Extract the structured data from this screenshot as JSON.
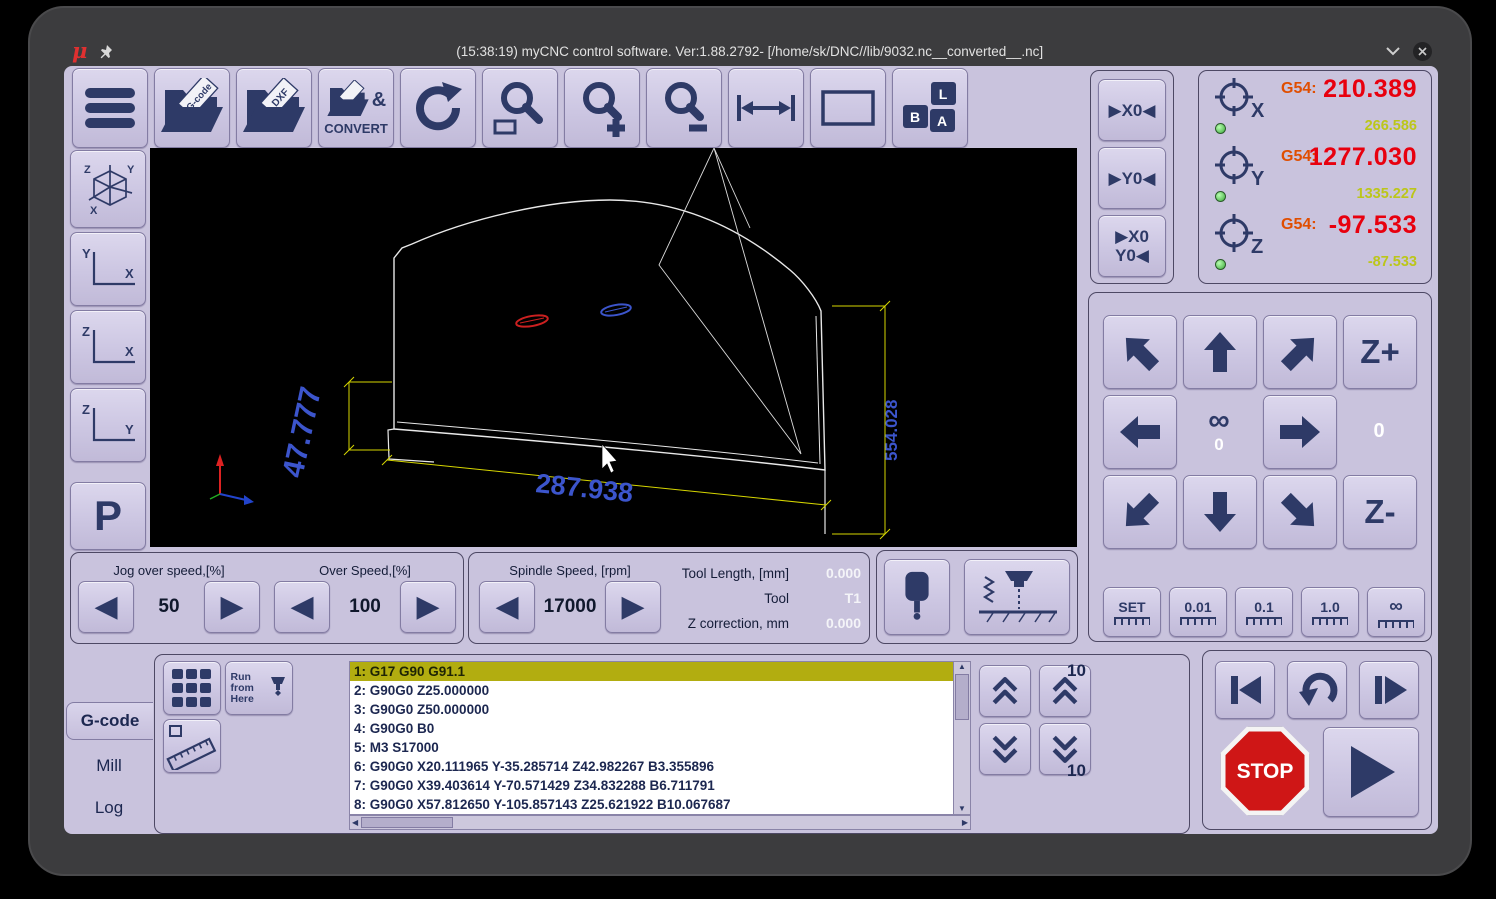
{
  "window": {
    "logo": "μ",
    "title": "(15:38:19) myCNC control software. Ver:1.88.2792- [/home/sk/DNC//lib/9032.nc__converted__.nc]"
  },
  "icons": {
    "left": "◀",
    "right": "▶",
    "up": "▲",
    "down": "▼"
  },
  "toolbar": {
    "gcode_folder_label": "G-code",
    "dxf_folder_label": "DXF",
    "convert_amp": "&",
    "convert_label": "CONVERT",
    "key_l": "L",
    "key_b": "B",
    "key_a": "A"
  },
  "sidebar": {
    "axis_x": "X",
    "axis_y": "Y",
    "axis_z": "Z",
    "park_label": "P"
  },
  "zero": {
    "x": "▶X0◀",
    "y": "▶Y0◀",
    "xy1": "▶X0",
    "xy2": "Y0◀"
  },
  "dro": {
    "rows": [
      {
        "axis": "X",
        "wcs": "G54:",
        "value": "210.389",
        "machine": "266.586"
      },
      {
        "axis": "Y",
        "wcs": "G54:",
        "value": "1277.030",
        "machine": "1335.227"
      },
      {
        "axis": "Z",
        "wcs": "G54:",
        "value": "-97.533",
        "machine": "-87.533"
      }
    ]
  },
  "canvas": {
    "dim_left": "47.777",
    "dim_bottom": "287.938",
    "dim_right": "554.028"
  },
  "speeds": {
    "jog_label": "Jog over speed,[%]",
    "jog_value": "50",
    "over_label": "Over Speed,[%]",
    "over_value": "100",
    "spindle_label": "Spindle Speed, [rpm]",
    "spindle_value": "17000"
  },
  "tool": {
    "length_label": "Tool Length, [mm]",
    "length_value": "0.000",
    "tool_label": "Tool",
    "tool_value": "T1",
    "zcorr_label": "Z correction, mm",
    "zcorr_value": "0.000"
  },
  "jogpad": {
    "z_plus": "Z+",
    "z_minus": "Z-",
    "infinity": "∞",
    "center_value": "0",
    "side_value": "0",
    "steps": [
      "SET",
      "0.01",
      "0.1",
      "1.0",
      "∞"
    ]
  },
  "gcode": {
    "tabs": [
      "G-code",
      "Mill",
      "Log"
    ],
    "run_from_here": "Run from Here",
    "page_step_top": "10",
    "page_step_bottom": "10",
    "lines": [
      "1: G17 G90 G91.1",
      "2: G90G0 Z25.000000",
      "3: G90G0 Z50.000000",
      "4: G90G0 B0",
      "5: M3 S17000",
      "6: G90G0 X20.111965 Y-35.285714 Z42.982267 B3.355896",
      "7: G90G0 X39.403614 Y-70.571429 Z34.832288 B6.711791",
      "8: G90G0 X57.812650 Y-105.857143 Z25.621922 B10.067687"
    ]
  },
  "transport": {
    "stop_label": "STOP"
  }
}
